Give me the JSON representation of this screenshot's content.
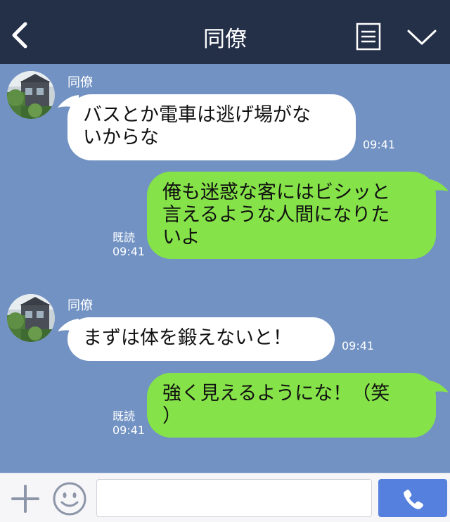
{
  "header": {
    "title": "同僚",
    "back_icon": "chevron-left-icon",
    "menu_icon": "menu-icon",
    "collapse_icon": "chevron-down-icon"
  },
  "messages": [
    {
      "side": "left",
      "sender": "同僚",
      "lines": [
        "バスとか電車は逃げ場がな",
        "いからな"
      ],
      "time": "09:41"
    },
    {
      "side": "right",
      "read": "既読",
      "lines": [
        "俺も迷惑な客にはビシッと",
        "言えるような人間になりた",
        "いよ"
      ],
      "time": "09:41"
    },
    {
      "side": "left",
      "sender": "同僚",
      "lines": [
        "まずは体を鍛えないと！"
      ],
      "time": "09:41"
    },
    {
      "side": "right",
      "read": "既読",
      "lines": [
        "強く見えるようにな！（笑",
        "）"
      ],
      "time": "09:41"
    }
  ],
  "input": {
    "placeholder": "",
    "value": ""
  },
  "colors": {
    "header_bg": "#242f48",
    "chat_bg": "#7192c3",
    "left_bubble": "#ffffff",
    "right_bubble": "#85e249",
    "call_button": "#5580dd"
  }
}
